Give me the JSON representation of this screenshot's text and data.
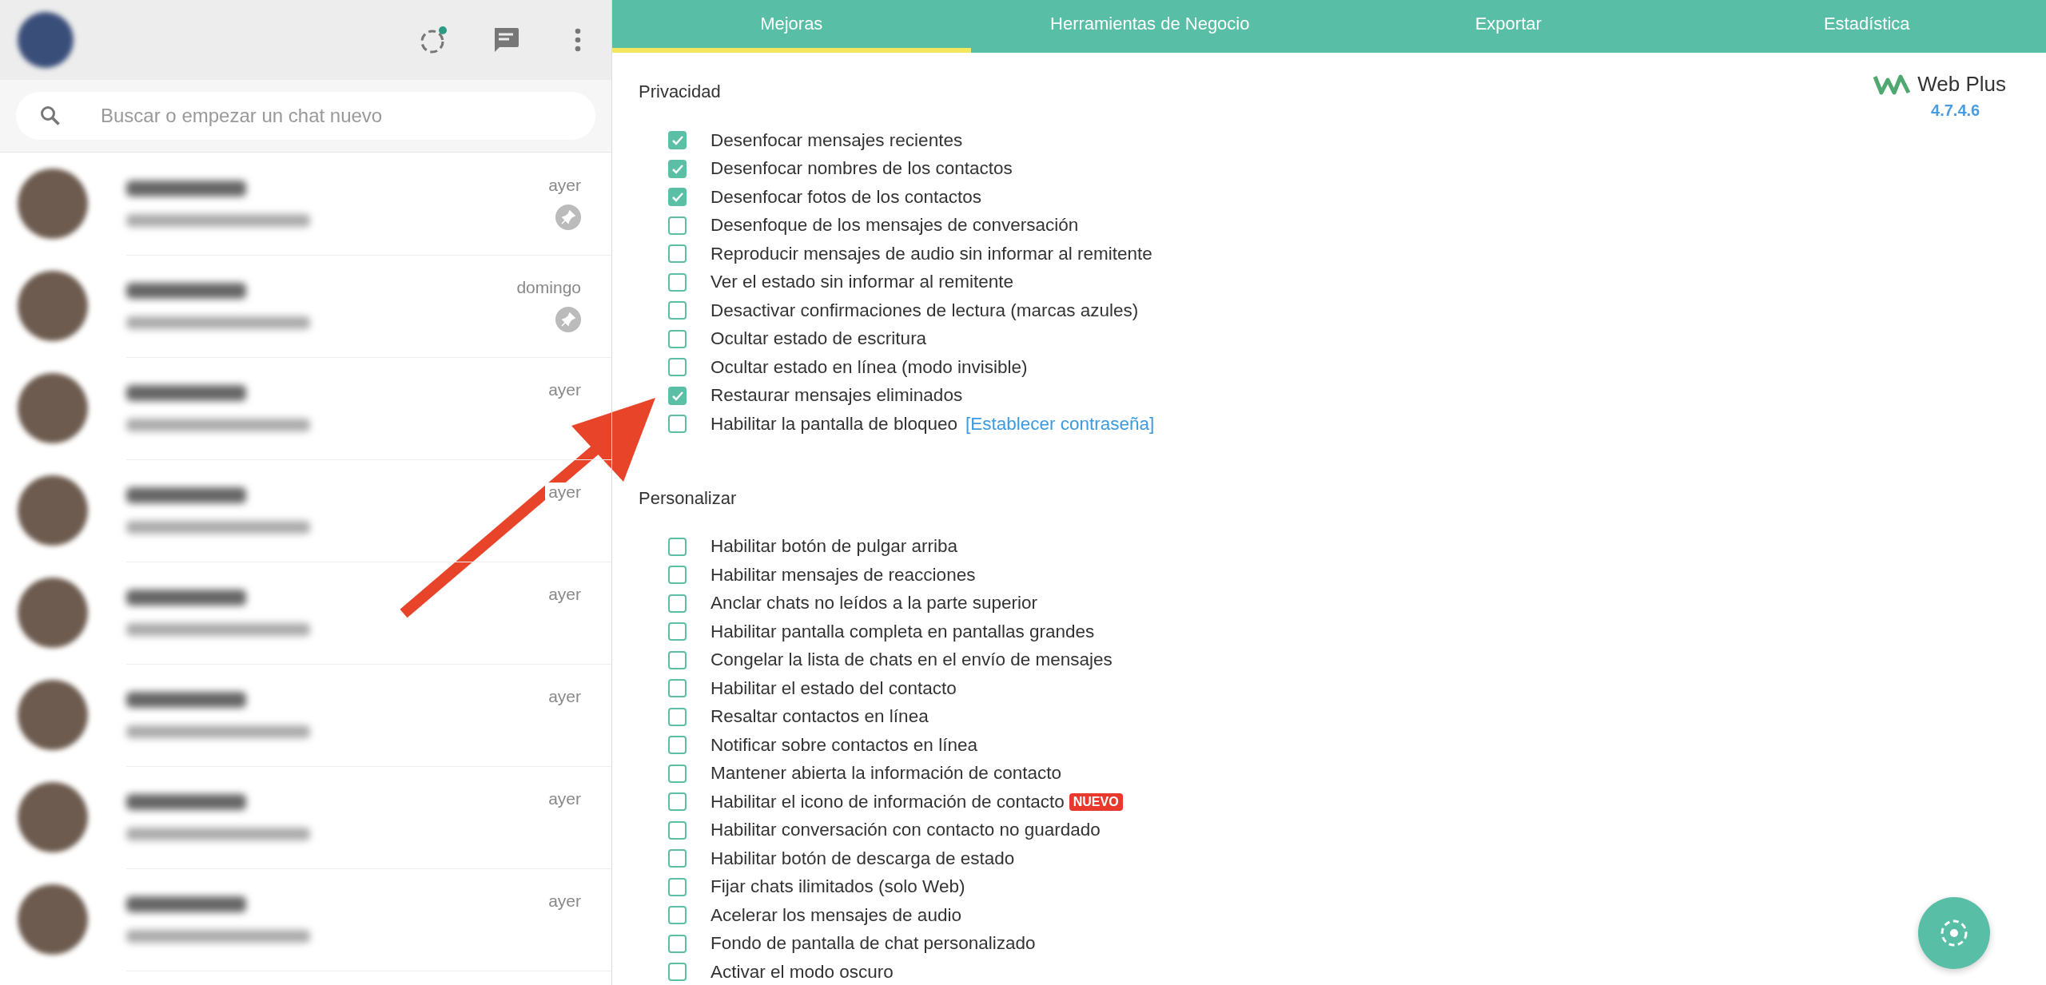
{
  "sidebar": {
    "search": {
      "placeholder": "Buscar o empezar un chat nuevo"
    },
    "chats": [
      {
        "time": "ayer",
        "pinned": true
      },
      {
        "time": "domingo",
        "pinned": true
      },
      {
        "time": "ayer",
        "pinned": false
      },
      {
        "time": "ayer",
        "pinned": false
      },
      {
        "time": "ayer",
        "pinned": false
      },
      {
        "time": "ayer",
        "pinned": false
      },
      {
        "time": "ayer",
        "pinned": false
      },
      {
        "time": "ayer",
        "pinned": false
      }
    ]
  },
  "tabs": [
    {
      "label": "Mejoras",
      "selected": true
    },
    {
      "label": "Herramientas de Negocio",
      "selected": false
    },
    {
      "label": "Exportar",
      "selected": false
    },
    {
      "label": "Estadística",
      "selected": false
    }
  ],
  "logo": {
    "name": "Web Plus",
    "version": "4.7.4.6"
  },
  "sections": [
    {
      "title": "Privacidad",
      "options": [
        {
          "label": "Desenfocar mensajes recientes",
          "checked": true
        },
        {
          "label": "Desenfocar nombres de los contactos",
          "checked": true
        },
        {
          "label": "Desenfocar fotos de los contactos",
          "checked": true
        },
        {
          "label": "Desenfoque de los mensajes de conversación",
          "checked": false
        },
        {
          "label": "Reproducir mensajes de audio sin informar al remitente",
          "checked": false
        },
        {
          "label": "Ver el estado sin informar al remitente",
          "checked": false
        },
        {
          "label": "Desactivar confirmaciones de lectura (marcas azules)",
          "checked": false
        },
        {
          "label": "Ocultar estado de escritura",
          "checked": false
        },
        {
          "label": "Ocultar estado en línea (modo invisible)",
          "checked": false
        },
        {
          "label": "Restaurar mensajes eliminados",
          "checked": true
        },
        {
          "label": "Habilitar la pantalla de bloqueo",
          "checked": false,
          "link": "[Establecer contraseña]"
        }
      ]
    },
    {
      "title": "Personalizar",
      "options": [
        {
          "label": "Habilitar botón de pulgar arriba",
          "checked": false
        },
        {
          "label": "Habilitar mensajes de reacciones",
          "checked": false
        },
        {
          "label": "Anclar chats no leídos a la parte superior",
          "checked": false
        },
        {
          "label": "Habilitar pantalla completa en pantallas grandes",
          "checked": false
        },
        {
          "label": "Congelar la lista de chats en el envío de mensajes",
          "checked": false
        },
        {
          "label": "Habilitar el estado del contacto",
          "checked": false
        },
        {
          "label": "Resaltar contactos en línea",
          "checked": false
        },
        {
          "label": "Notificar sobre contactos en línea",
          "checked": false
        },
        {
          "label": "Mantener abierta la información de contacto",
          "checked": false
        },
        {
          "label": "Habilitar el icono de información de contacto",
          "checked": false,
          "badge": "NUEVO"
        },
        {
          "label": "Habilitar conversación con contacto no guardado",
          "checked": false
        },
        {
          "label": "Habilitar botón de descarga de estado",
          "checked": false
        },
        {
          "label": "Fijar chats ilimitados (solo Web)",
          "checked": false
        },
        {
          "label": "Acelerar los mensajes de audio",
          "checked": false
        },
        {
          "label": "Fondo de pantalla de chat personalizado",
          "checked": false
        },
        {
          "label": "Activar el modo oscuro",
          "checked": false
        }
      ]
    }
  ]
}
